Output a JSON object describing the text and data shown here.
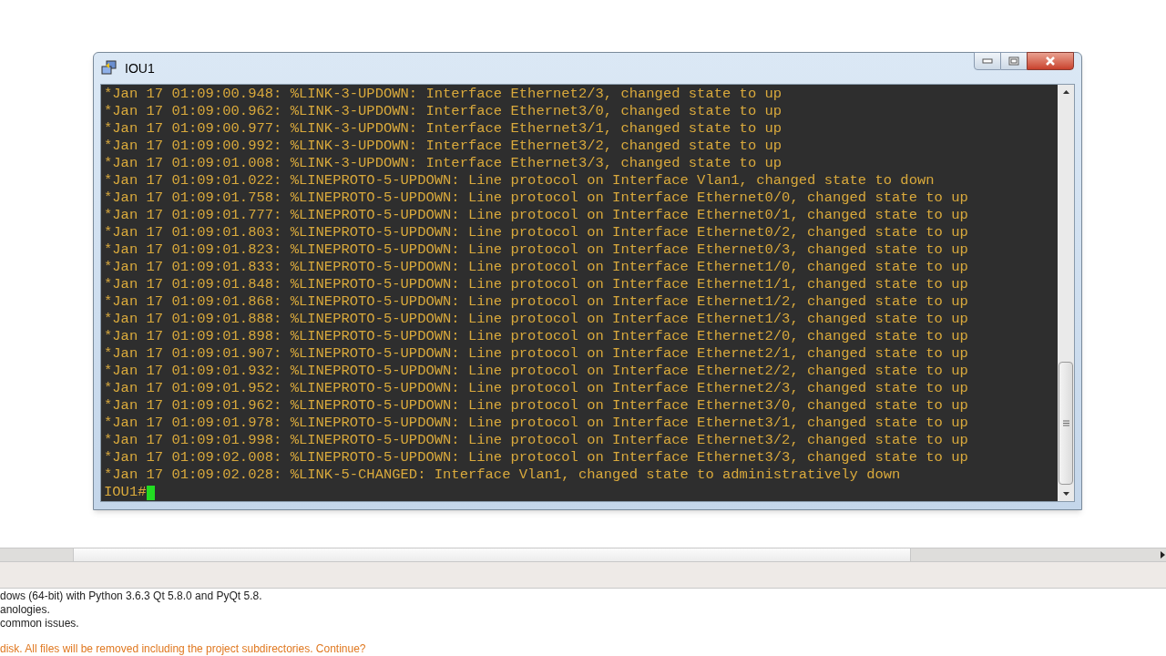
{
  "window": {
    "title": "IOU1"
  },
  "terminal": {
    "lines": [
      "*Jan 17 01:09:00.948: %LINK-3-UPDOWN: Interface Ethernet2/3, changed state to up",
      "*Jan 17 01:09:00.962: %LINK-3-UPDOWN: Interface Ethernet3/0, changed state to up",
      "*Jan 17 01:09:00.977: %LINK-3-UPDOWN: Interface Ethernet3/1, changed state to up",
      "*Jan 17 01:09:00.992: %LINK-3-UPDOWN: Interface Ethernet3/2, changed state to up",
      "*Jan 17 01:09:01.008: %LINK-3-UPDOWN: Interface Ethernet3/3, changed state to up",
      "*Jan 17 01:09:01.022: %LINEPROTO-5-UPDOWN: Line protocol on Interface Vlan1, changed state to down",
      "*Jan 17 01:09:01.758: %LINEPROTO-5-UPDOWN: Line protocol on Interface Ethernet0/0, changed state to up",
      "*Jan 17 01:09:01.777: %LINEPROTO-5-UPDOWN: Line protocol on Interface Ethernet0/1, changed state to up",
      "*Jan 17 01:09:01.803: %LINEPROTO-5-UPDOWN: Line protocol on Interface Ethernet0/2, changed state to up",
      "*Jan 17 01:09:01.823: %LINEPROTO-5-UPDOWN: Line protocol on Interface Ethernet0/3, changed state to up",
      "*Jan 17 01:09:01.833: %LINEPROTO-5-UPDOWN: Line protocol on Interface Ethernet1/0, changed state to up",
      "*Jan 17 01:09:01.848: %LINEPROTO-5-UPDOWN: Line protocol on Interface Ethernet1/1, changed state to up",
      "*Jan 17 01:09:01.868: %LINEPROTO-5-UPDOWN: Line protocol on Interface Ethernet1/2, changed state to up",
      "*Jan 17 01:09:01.888: %LINEPROTO-5-UPDOWN: Line protocol on Interface Ethernet1/3, changed state to up",
      "*Jan 17 01:09:01.898: %LINEPROTO-5-UPDOWN: Line protocol on Interface Ethernet2/0, changed state to up",
      "*Jan 17 01:09:01.907: %LINEPROTO-5-UPDOWN: Line protocol on Interface Ethernet2/1, changed state to up",
      "*Jan 17 01:09:01.932: %LINEPROTO-5-UPDOWN: Line protocol on Interface Ethernet2/2, changed state to up",
      "*Jan 17 01:09:01.952: %LINEPROTO-5-UPDOWN: Line protocol on Interface Ethernet2/3, changed state to up",
      "*Jan 17 01:09:01.962: %LINEPROTO-5-UPDOWN: Line protocol on Interface Ethernet3/0, changed state to up",
      "*Jan 17 01:09:01.978: %LINEPROTO-5-UPDOWN: Line protocol on Interface Ethernet3/1, changed state to up",
      "*Jan 17 01:09:01.998: %LINEPROTO-5-UPDOWN: Line protocol on Interface Ethernet3/2, changed state to up",
      "*Jan 17 01:09:02.008: %LINEPROTO-5-UPDOWN: Line protocol on Interface Ethernet3/3, changed state to up",
      "*Jan 17 01:09:02.028: %LINK-5-CHANGED: Interface Vlan1, changed state to administratively down"
    ],
    "prompt": "IOU1#"
  },
  "console": {
    "lines": [
      {
        "kind": "info",
        "text": "dows (64-bit) with Python 3.6.3 Qt 5.8.0 and PyQt 5.8."
      },
      {
        "kind": "info",
        "text": "anologies."
      },
      {
        "kind": "info",
        "text": "common issues."
      },
      {
        "kind": "warning",
        "text": "disk. All files will be removed including the project subdirectories. Continue?"
      }
    ]
  }
}
